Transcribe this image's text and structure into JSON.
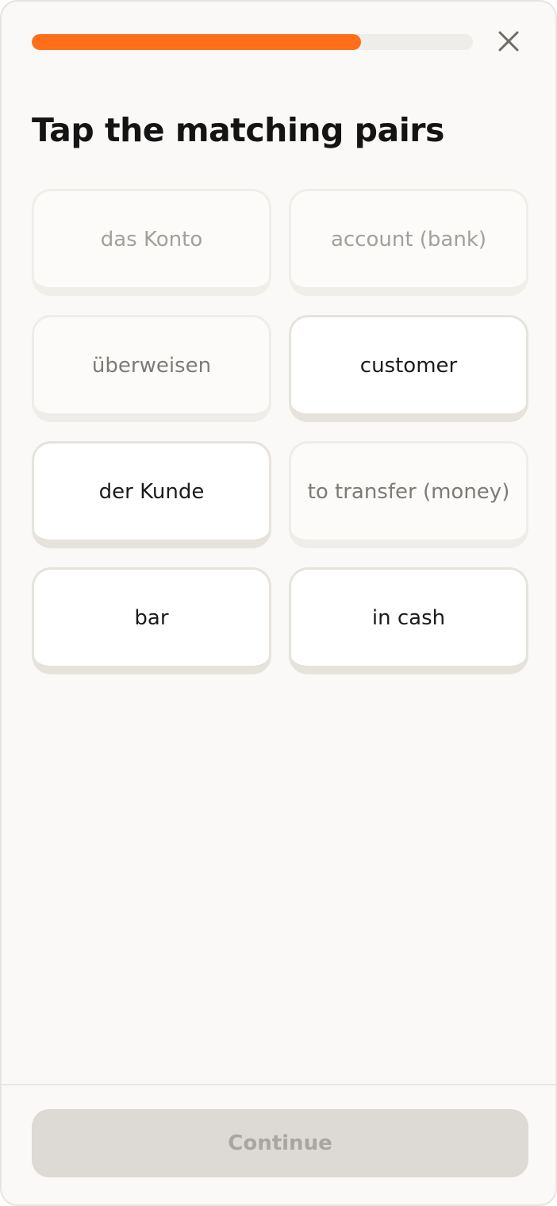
{
  "progress": {
    "fraction": 0.747,
    "fill_color": "#ff6f1a",
    "track_color": "#efede9"
  },
  "header": {
    "close_icon": "close-icon"
  },
  "title": "Tap the matching pairs",
  "cards": [
    {
      "label": "das Konto",
      "state": "inactive"
    },
    {
      "label": "account (bank)",
      "state": "inactive"
    },
    {
      "label": "überweisen",
      "state": "dimmed"
    },
    {
      "label": "customer",
      "state": "active"
    },
    {
      "label": "der Kunde",
      "state": "active"
    },
    {
      "label": "to transfer (money)",
      "state": "dimmed"
    },
    {
      "label": "bar",
      "state": "active"
    },
    {
      "label": "in cash",
      "state": "active"
    }
  ],
  "footer": {
    "continue_label": "Continue",
    "continue_state": "disabled"
  }
}
